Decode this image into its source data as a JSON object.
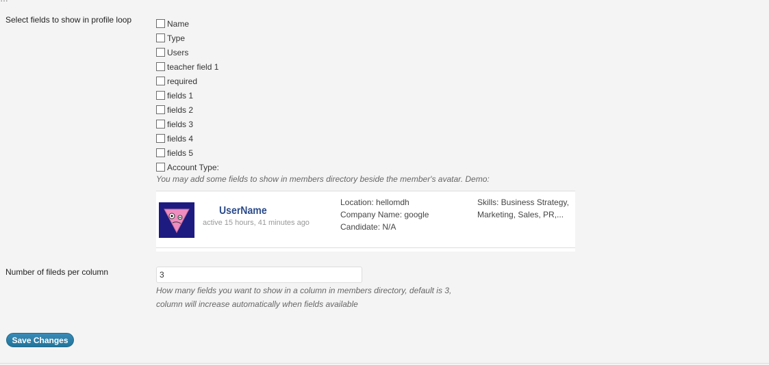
{
  "top_cut_text": "…",
  "profile_loop": {
    "label": "Select fields to show in profile loop",
    "options": [
      {
        "label": "Name",
        "checked": false
      },
      {
        "label": "Type",
        "checked": false
      },
      {
        "label": "Users",
        "checked": false
      },
      {
        "label": "teacher field 1",
        "checked": false
      },
      {
        "label": "required",
        "checked": false
      },
      {
        "label": "fields 1",
        "checked": false
      },
      {
        "label": "fields 2",
        "checked": false
      },
      {
        "label": "fields 3",
        "checked": false
      },
      {
        "label": "fields 4",
        "checked": false
      },
      {
        "label": "fields 5",
        "checked": false
      },
      {
        "label": "Account Type:",
        "checked": false
      }
    ],
    "description": "You may add some fields to show in members directory beside the member's avatar. Demo:"
  },
  "demo": {
    "username": "UserName",
    "active": "active 15 hours, 41 minutes ago",
    "col1": [
      "Location: hellomdh",
      "Company Name: google",
      "Candidate: N/A"
    ],
    "col2": [
      "Skills: Business Strategy,",
      "Marketing, Sales, PR,..."
    ],
    "avatar_bg": "#1d1b80",
    "avatar_face": "#f08cc0"
  },
  "per_column": {
    "label": "Number of fileds per column",
    "value": "3",
    "description_line1": "How many fields you want to show in a column in members directory, default is 3,",
    "description_line2": "column will increase automatically when fields available"
  },
  "save_button": "Save Changes"
}
